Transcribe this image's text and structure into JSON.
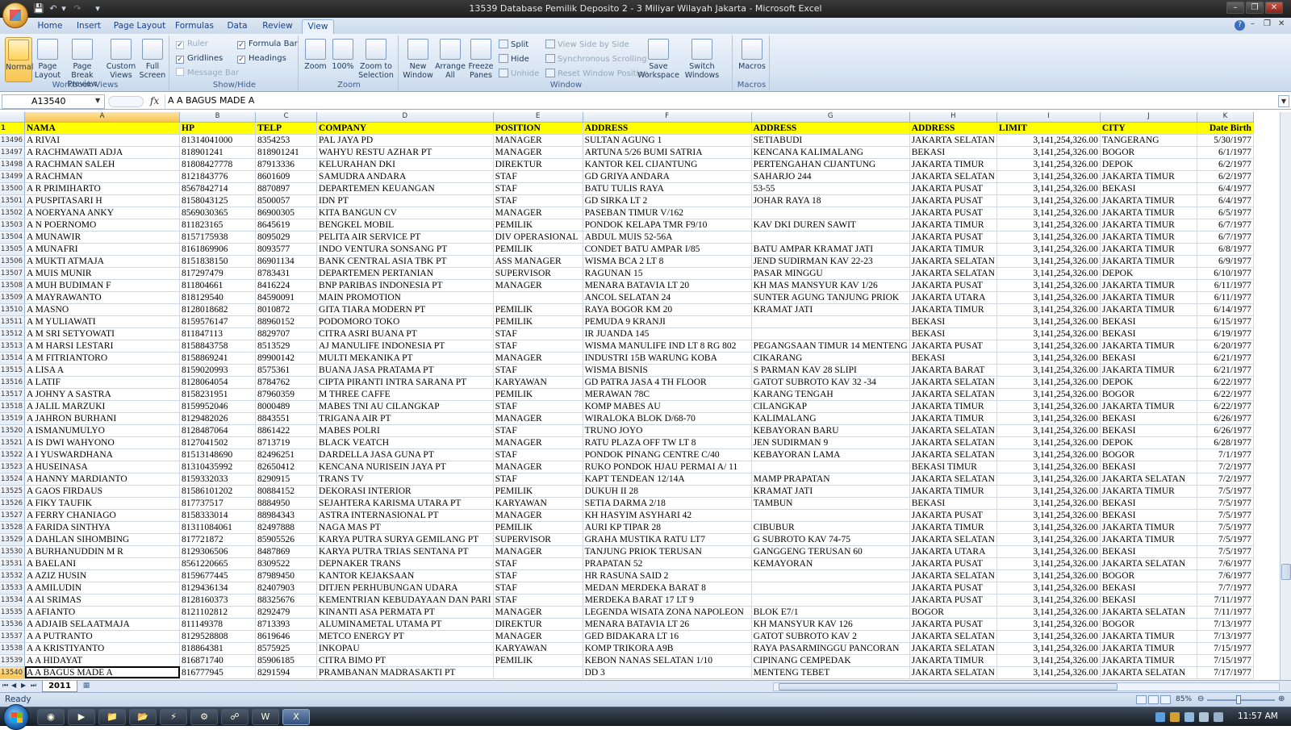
{
  "window": {
    "title": "13539 Database Pemilik Deposito 2 - 3 Miliyar Wilayah Jakarta - Microsoft Excel"
  },
  "ribbon_tabs": [
    "Home",
    "Insert",
    "Page Layout",
    "Formulas",
    "Data",
    "Review",
    "View"
  ],
  "ribbon": {
    "workbook_views": {
      "label": "Workbook Views",
      "normal": "Normal",
      "page_layout": "Page Layout",
      "page_break_preview": "Page Break Preview",
      "custom_views": "Custom Views",
      "full_screen": "Full Screen"
    },
    "show_hide": {
      "label": "Show/Hide",
      "ruler": "Ruler",
      "gridlines": "Gridlines",
      "message_bar": "Message Bar",
      "formula_bar": "Formula Bar",
      "headings": "Headings"
    },
    "zoom": {
      "label": "Zoom",
      "zoom": "Zoom",
      "hundred": "100%",
      "zoom_to_selection": "Zoom to Selection"
    },
    "window": {
      "label": "Window",
      "new_window": "New Window",
      "arrange_all": "Arrange All",
      "freeze_panes": "Freeze Panes",
      "split": "Split",
      "hide": "Hide",
      "unhide": "Unhide",
      "view_side_by_side": "View Side by Side",
      "synchronous_scrolling": "Synchronous Scrolling",
      "reset_window_position": "Reset Window Position",
      "save_workspace": "Save Workspace",
      "switch_windows": "Switch Windows"
    },
    "macros": {
      "label": "Macros",
      "macros": "Macros"
    }
  },
  "formula_bar": {
    "name_box": "A13540",
    "fx": "fx",
    "content": "A A BAGUS MADE A"
  },
  "columns": [
    "A",
    "B",
    "C",
    "D",
    "E",
    "F",
    "G",
    "H",
    "I",
    "J",
    "K"
  ],
  "header_row": {
    "row": "1",
    "cells": [
      "NAMA",
      "HP",
      "TELP",
      "COMPANY",
      "POSITION",
      "ADDRESS",
      "ADDRESS",
      "ADDRESS",
      "LIMIT",
      "CITY",
      "Date Birth"
    ]
  },
  "rows": [
    {
      "n": "13496",
      "c": [
        "A RIVAI",
        "81314041000",
        "8354253",
        "PAL JAYA PD",
        "MANAGER",
        "SULTAN AGUNG 1",
        "SETIABUDI",
        "JAKARTA SELATAN",
        "3,141,254,326.00",
        "TANGERANG",
        "5/30/1977"
      ]
    },
    {
      "n": "13497",
      "c": [
        "A RACHMAWATI ADJA",
        "818901241",
        "818901241",
        "WAHYU RESTU AZHAR PT",
        "MANAGER",
        "ARTUNA 5/26 BUMI SATRIA",
        "KENCANA KALIMALANG",
        "BEKASI",
        "3,141,254,326.00",
        "BOGOR",
        "6/1/1977"
      ]
    },
    {
      "n": "13498",
      "c": [
        "A RACHMAN SALEH",
        "81808427778",
        "87913336",
        "KELURAHAN DKI",
        "DIREKTUR",
        "KANTOR KEL CIJANTUNG",
        "PERTENGAHAN CIJANTUNG",
        "JAKARTA TIMUR",
        "3,141,254,326.00",
        "DEPOK",
        "6/2/1977"
      ]
    },
    {
      "n": "13499",
      "c": [
        "A RACHMAN",
        "8121843776",
        "8601609",
        "SAMUDRA ANDARA",
        "STAF",
        "GD GRIYA ANDARA",
        "SAHARJO 244",
        "JAKARTA SELATAN",
        "3,141,254,326.00",
        "JAKARTA TIMUR",
        "6/2/1977"
      ]
    },
    {
      "n": "13500",
      "c": [
        "A R PRIMIHARTO",
        "8567842714",
        "8870897",
        "DEPARTEMEN KEUANGAN",
        "STAF",
        "BATU TULIS RAYA",
        "53-55",
        "JAKARTA PUSAT",
        "3,141,254,326.00",
        "BEKASI",
        "6/4/1977"
      ]
    },
    {
      "n": "13501",
      "c": [
        "A PUSPITASARI H",
        "8158043125",
        "8500057",
        "IDN PT",
        "STAF",
        "GD SIRKA LT 2",
        "JOHAR RAYA 18",
        "JAKARTA PUSAT",
        "3,141,254,326.00",
        "JAKARTA TIMUR",
        "6/4/1977"
      ]
    },
    {
      "n": "13502",
      "c": [
        "A NOERYANA ANKY",
        "8569030365",
        "86900305",
        "KITA BANGUN CV",
        "MANAGER",
        "PASEBAN TIMUR V/162",
        "",
        "JAKARTA PUSAT",
        "3,141,254,326.00",
        "JAKARTA TIMUR",
        "6/5/1977"
      ]
    },
    {
      "n": "13503",
      "c": [
        "A N POERNOMO",
        "811823165",
        "8645619",
        "BENGKEL MOBIL",
        "PEMILIK",
        "PONDOK KELAPA TMR F9/10",
        "KAV DKI DUREN SAWIT",
        "JAKARTA TIMUR",
        "3,141,254,326.00",
        "JAKARTA TIMUR",
        "6/7/1977"
      ]
    },
    {
      "n": "13504",
      "c": [
        "A MUNAWIR",
        "8157175938",
        "8095029",
        "PELITA AIR SERVICE PT",
        "DIV OPERASIONAL",
        "ABDUL MUIS 52-56A",
        "",
        "JAKARTA PUSAT",
        "3,141,254,326.00",
        "JAKARTA TIMUR",
        "6/7/1977"
      ]
    },
    {
      "n": "13505",
      "c": [
        "A MUNAFRI",
        "8161869906",
        "8093577",
        "INDO VENTURA SONSANG PT",
        "PEMILIK",
        "CONDET BATU AMPAR I/85",
        "BATU AMPAR KRAMAT JATI",
        "JAKARTA TIMUR",
        "3,141,254,326.00",
        "JAKARTA TIMUR",
        "6/8/1977"
      ]
    },
    {
      "n": "13506",
      "c": [
        "A MUKTI ATMAJA",
        "8151838150",
        "86901134",
        "BANK CENTRAL ASIA TBK PT",
        "ASS MANAGER",
        "WISMA BCA 2  LT 8",
        "JEND SUDIRMAN KAV 22-23",
        "JAKARTA SELATAN",
        "3,141,254,326.00",
        "JAKARTA TIMUR",
        "6/9/1977"
      ]
    },
    {
      "n": "13507",
      "c": [
        "A MUIS MUNIR",
        "817297479",
        "8783431",
        "DEPARTEMEN PERTANIAN",
        "SUPERVISOR",
        "RAGUNAN 15",
        "PASAR MINGGU",
        "JAKARTA SELATAN",
        "3,141,254,326.00",
        "DEPOK",
        "6/10/1977"
      ]
    },
    {
      "n": "13508",
      "c": [
        "A MUH BUDIMAN F",
        "811804661",
        "8416224",
        "BNP PARIBAS INDONESIA PT",
        "MANAGER",
        "MENARA BATAVIA LT 20",
        "KH MAS MANSYUR KAV 1/26",
        "JAKARTA PUSAT",
        "3,141,254,326.00",
        "JAKARTA TIMUR",
        "6/11/1977"
      ]
    },
    {
      "n": "13509",
      "c": [
        "A MAYRAWANTO",
        "818129540",
        "84590091",
        "MAIN PROMOTION",
        "",
        "ANCOL SELATAN 24",
        "SUNTER AGUNG TANJUNG PRIOK",
        "JAKARTA UTARA",
        "3,141,254,326.00",
        "JAKARTA TIMUR",
        "6/11/1977"
      ]
    },
    {
      "n": "13510",
      "c": [
        "A MASNO",
        "8128018682",
        "8010872",
        "GITA TIARA MODERN PT",
        "PEMILIK",
        "RAYA BOGOR KM 20",
        "KRAMAT JATI",
        "JAKARTA TIMUR",
        "3,141,254,326.00",
        "JAKARTA TIMUR",
        "6/14/1977"
      ]
    },
    {
      "n": "13511",
      "c": [
        "A M YULIAWATI",
        "8159576147",
        "88960152",
        "PODOMORO TOKO",
        "PEMILIK",
        "PEMUDA 9 KRANJI",
        "",
        "BEKASI",
        "3,141,254,326.00",
        "BEKASI",
        "6/15/1977"
      ]
    },
    {
      "n": "13512",
      "c": [
        "A M SRI SETYOWATI",
        "811847113",
        "8829707",
        "CITRA ASRI BUANA PT",
        "STAF",
        "IR JUANDA 145",
        "",
        "BEKASI",
        "3,141,254,326.00",
        "BEKASI",
        "6/19/1977"
      ]
    },
    {
      "n": "13513",
      "c": [
        "A M HARSI LESTARI",
        "8158843758",
        "8513529",
        "AJ MANULIFE INDONESIA PT",
        "STAF",
        "WISMA MANULIFE IND LT 8 RG 802",
        "PEGANGSAAN TIMUR 14 MENTENG",
        "JAKARTA PUSAT",
        "3,141,254,326.00",
        "JAKARTA TIMUR",
        "6/20/1977"
      ]
    },
    {
      "n": "13514",
      "c": [
        "A M FITRIANTORO",
        "8158869241",
        "89900142",
        "MULTI MEKANIKA PT",
        "MANAGER",
        "INDUSTRI 15B WARUNG KOBA",
        "CIKARANG",
        "BEKASI",
        "3,141,254,326.00",
        "BEKASI",
        "6/21/1977"
      ]
    },
    {
      "n": "13515",
      "c": [
        "A LISA A",
        "8159020993",
        "8575361",
        "BUANA JASA PRATAMA PT",
        "STAF",
        "WISMA BISNIS",
        "S PARMAN KAV 28 SLIPI",
        "JAKARTA BARAT",
        "3,141,254,326.00",
        "JAKARTA TIMUR",
        "6/21/1977"
      ]
    },
    {
      "n": "13516",
      "c": [
        "A LATIF",
        "8128064054",
        "8784762",
        "CIPTA PIRANTI INTRA SARANA PT",
        "KARYAWAN",
        "GD PATRA JASA 4 TH FLOOR",
        "GATOT SUBROTO KAV 32 -34",
        "JAKARTA SELATAN",
        "3,141,254,326.00",
        "DEPOK",
        "6/22/1977"
      ]
    },
    {
      "n": "13517",
      "c": [
        "A JOHNY A SASTRA",
        "8158231951",
        "87960359",
        "M THREE CAFFE",
        "PEMILIK",
        "MERAWAN 78C",
        "KARANG TENGAH",
        "JAKARTA SELATAN",
        "3,141,254,326.00",
        "BOGOR",
        "6/22/1977"
      ]
    },
    {
      "n": "13518",
      "c": [
        "A JALIL MARZUKI",
        "8159952046",
        "8000489",
        "MABES TNI AU CILANGKAP",
        "STAF",
        "KOMP MABES AU",
        "CILANGKAP",
        "JAKARTA TIMUR",
        "3,141,254,326.00",
        "JAKARTA TIMUR",
        "6/22/1977"
      ]
    },
    {
      "n": "13519",
      "c": [
        "A JAHRON BURHANI",
        "8129482026",
        "8843551",
        "TRIGANA AIR PT",
        "MANAGER",
        "WIRALOKA BLOK D/68-70",
        "KALIMALANG",
        "JAKARTA TIMUR",
        "3,141,254,326.00",
        "BEKASI",
        "6/26/1977"
      ]
    },
    {
      "n": "13520",
      "c": [
        "A ISMANUMULYO",
        "8128487064",
        "8861422",
        "MABES POLRI",
        "STAF",
        "TRUNO JOYO",
        "KEBAYORAN BARU",
        "JAKARTA SELATAN",
        "3,141,254,326.00",
        "BEKASI",
        "6/26/1977"
      ]
    },
    {
      "n": "13521",
      "c": [
        "A IS DWI WAHYONO",
        "8127041502",
        "8713719",
        "BLACK VEATCH",
        "MANAGER",
        "RATU PLAZA OFF TW LT 8",
        "JEN SUDIRMAN 9",
        "JAKARTA SELATAN",
        "3,141,254,326.00",
        "DEPOK",
        "6/28/1977"
      ]
    },
    {
      "n": "13522",
      "c": [
        "A I YUSWARDHANA",
        "81513148690",
        "82496251",
        "DARDELLA JASA GUNA PT",
        "STAF",
        "PONDOK PINANG CENTRE C/40",
        "KEBAYORAN LAMA",
        "JAKARTA SELATAN",
        "3,141,254,326.00",
        "BOGOR",
        "7/1/1977"
      ]
    },
    {
      "n": "13523",
      "c": [
        "A HUSEINASA",
        "81310435992",
        "82650412",
        "KENCANA NURISEIN JAYA PT",
        "MANAGER",
        "RUKO PONDOK HJAU PERMAI A/ 11",
        "",
        "BEKASI TIMUR",
        "3,141,254,326.00",
        "BEKASI",
        "7/2/1977"
      ]
    },
    {
      "n": "13524",
      "c": [
        "A HANNY MARDIANTO",
        "8159332033",
        "8290915",
        "TRANS TV",
        "STAF",
        "KAPT TENDEAN 12/14A",
        "MAMP PRAPATAN",
        "JAKARTA SELATAN",
        "3,141,254,326.00",
        "JAKARTA SELATAN",
        "7/2/1977"
      ]
    },
    {
      "n": "13525",
      "c": [
        "A GAOS FIRDAUS",
        "81586101202",
        "80884152",
        "DEKORASI INTERIOR",
        "PEMILIK",
        "DUKUH II 28",
        "KRAMAT JATI",
        "JAKARTA TIMUR",
        "3,141,254,326.00",
        "JAKARTA TIMUR",
        "7/5/1977"
      ]
    },
    {
      "n": "13526",
      "c": [
        "A FIKY TAUFIK",
        "817737517",
        "8884950",
        "SEJAHTERA KARISMA UTARA PT",
        "KARYAWAN",
        "SETIA DARMA 2/18",
        "TAMBUN",
        "BEKASI",
        "3,141,254,326.00",
        "BEKASI",
        "7/5/1977"
      ]
    },
    {
      "n": "13527",
      "c": [
        "A FERRY CHANIAGO",
        "8158333014",
        "88984343",
        "ASTRA INTERNASIONAL PT",
        "MANAGER",
        "KH HASYIM ASYHARI 42",
        "",
        "JAKARTA PUSAT",
        "3,141,254,326.00",
        "BEKASI",
        "7/5/1977"
      ]
    },
    {
      "n": "13528",
      "c": [
        "A FARIDA SINTHYA",
        "81311084061",
        "82497888",
        "NAGA MAS PT",
        "PEMILIK",
        "AURI KP TIPAR 28",
        "CIBUBUR",
        "JAKARTA TIMUR",
        "3,141,254,326.00",
        "JAKARTA TIMUR",
        "7/5/1977"
      ]
    },
    {
      "n": "13529",
      "c": [
        "A DAHLAN SIHOMBING",
        "817721872",
        "85905526",
        "KARYA PUTRA SURYA GEMILANG PT",
        "SUPERVISOR",
        "GRAHA MUSTIKA RATU LT7",
        "G SUBROTO KAV 74-75",
        "JAKARTA SELATAN",
        "3,141,254,326.00",
        "JAKARTA TIMUR",
        "7/5/1977"
      ]
    },
    {
      "n": "13530",
      "c": [
        "A BURHANUDDIN M R",
        "8129306506",
        "8487869",
        "KARYA PUTRA TRIAS SENTANA PT",
        "MANAGER",
        "TANJUNG PRIOK TERUSAN",
        "GANGGENG TERUSAN 60",
        "JAKARTA UTARA",
        "3,141,254,326.00",
        "BEKASI",
        "7/5/1977"
      ]
    },
    {
      "n": "13531",
      "c": [
        "A BAELANI",
        "8561220665",
        "8309522",
        "DEPNAKER TRANS",
        "STAF",
        "PRAPATAN 52",
        "KEMAYORAN",
        "JAKARTA PUSAT",
        "3,141,254,326.00",
        "JAKARTA SELATAN",
        "7/6/1977"
      ]
    },
    {
      "n": "13532",
      "c": [
        "A AZIZ HUSIN",
        "8159677445",
        "87989450",
        "KANTOR KEJAKSAAN",
        "STAF",
        "HR RASUNA SAID 2",
        "",
        "JAKARTA SELATAN",
        "3,141,254,326.00",
        "BOGOR",
        "7/6/1977"
      ]
    },
    {
      "n": "13533",
      "c": [
        "A AMILUDIN",
        "8129436134",
        "82407903",
        "DITJEN PERHUBUNGAN UDARA",
        "STAF",
        "MEDAN MERDEKA BARAT 8",
        "",
        "JAKARTA PUSAT",
        "3,141,254,326.00",
        "BEKASI",
        "7/7/1977"
      ]
    },
    {
      "n": "13534",
      "c": [
        "A AI SRIMAS",
        "8128160373",
        "88325676",
        "KEMENTRIAN KEBUDAYAAN DAN PARI",
        "STAF",
        "MERDEKA BARAT 17 LT 9",
        "",
        "JAKARTA PUSAT",
        "3,141,254,326.00",
        "BEKASI",
        "7/11/1977"
      ]
    },
    {
      "n": "13535",
      "c": [
        "A AFIANTO",
        "8121102812",
        "8292479",
        "KINANTI ASA PERMATA PT",
        "MANAGER",
        "LEGENDA WISATA ZONA NAPOLEON",
        "BLOK E7/1",
        "BOGOR",
        "3,141,254,326.00",
        "JAKARTA SELATAN",
        "7/11/1977"
      ]
    },
    {
      "n": "13536",
      "c": [
        "A ADJAIB SELAATMAJA",
        "811149378",
        "8713393",
        "ALUMINAMETAL UTAMA PT",
        "DIREKTUR",
        "MENARA BATAVIA LT 26",
        "KH MANSYUR KAV 126",
        "JAKARTA PUSAT",
        "3,141,254,326.00",
        "BOGOR",
        "7/13/1977"
      ]
    },
    {
      "n": "13537",
      "c": [
        "A A PUTRANTO",
        "8129528808",
        "8619646",
        "METCO ENERGY PT",
        "MANAGER",
        "GED BIDAKARA LT 16",
        "GATOT SUBROTO KAV 2",
        "JAKARTA SELATAN",
        "3,141,254,326.00",
        "JAKARTA TIMUR",
        "7/13/1977"
      ]
    },
    {
      "n": "13538",
      "c": [
        "A A KRISTIYANTO",
        "818864381",
        "8575925",
        "INKOPAU",
        "KARYAWAN",
        "KOMP TRIKORA A9B",
        "RAYA PASARMINGGU PANCORAN",
        "JAKARTA SELATAN",
        "3,141,254,326.00",
        "JAKARTA TIMUR",
        "7/15/1977"
      ]
    },
    {
      "n": "13539",
      "c": [
        "A A HIDAYAT",
        "816871740",
        "85906185",
        "CITRA BIMO PT",
        "PEMILIK",
        "KEBON NANAS SELATAN 1/10",
        "CIPINANG CEMPEDAK",
        "JAKARTA TIMUR",
        "3,141,254,326.00",
        "JAKARTA TIMUR",
        "7/15/1977"
      ]
    },
    {
      "n": "13540",
      "c": [
        "A A BAGUS MADE A",
        "816777945",
        "8291594",
        "PRAMBANAN MADRASAKTI PT",
        "",
        "DD 3",
        "MENTENG TEBET",
        "JAKARTA SELATAN",
        "3,141,254,326.00",
        "JAKARTA SELATAN",
        "7/17/1977"
      ]
    }
  ],
  "sheet_tabs": [
    "2011"
  ],
  "status": {
    "ready": "Ready",
    "zoom": "85%"
  },
  "taskbar": {
    "clock": "11:57 AM"
  }
}
